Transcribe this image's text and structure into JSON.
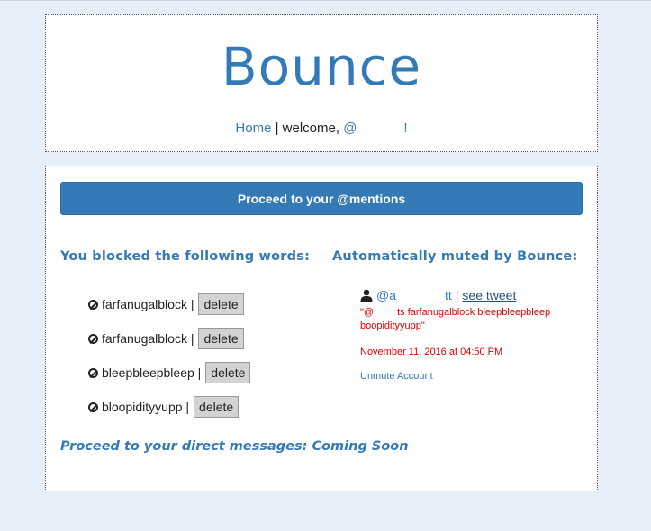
{
  "header": {
    "logo": "Bounce",
    "nav_home": "Home",
    "nav_separator": " | ",
    "welcome_text": "welcome, ",
    "user_handle_visible": "@",
    "user_handle_suffix": "!"
  },
  "main": {
    "mentions_button": "Proceed to your @mentions",
    "blocked_title": "You blocked the following words:",
    "muted_title": "Automatically muted by Bounce:",
    "blocked_words": [
      {
        "word": "farfanugalblock",
        "delete_label": "delete"
      },
      {
        "word": "farfanugalblock",
        "delete_label": "delete"
      },
      {
        "word": "bleepbleepbleep",
        "delete_label": "delete"
      },
      {
        "word": "bloopidityyupp",
        "delete_label": "delete"
      }
    ],
    "muted": {
      "user_prefix": "@a",
      "user_suffix": "tt",
      "separator": "|",
      "see_tweet": "see tweet",
      "tweet_prefix": "\"@",
      "tweet_body": "ts farfanugalblock bleepbleepbleep boopidityyupp\"",
      "date": "November 11, 2016 at 04:50 PM",
      "unmute": "Unmute Account"
    },
    "dm_note": "Proceed to your direct messages: Coming Soon"
  },
  "colors": {
    "background": "#e6eff9",
    "accent": "#337ab7",
    "alert": "#e00000"
  }
}
